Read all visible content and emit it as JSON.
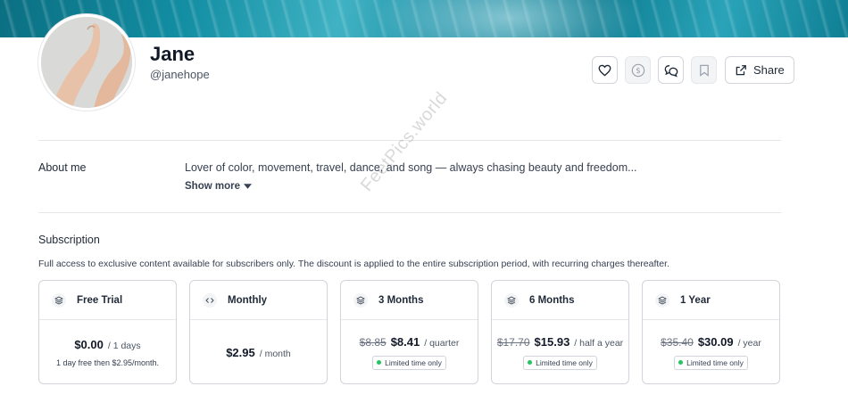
{
  "profile": {
    "name": "Jane",
    "handle": "@janehope"
  },
  "actions": {
    "share_label": "Share",
    "icons": [
      "heart-icon",
      "dollar-icon",
      "chat-icon",
      "bookmark-icon",
      "share-icon"
    ]
  },
  "about": {
    "label": "About me",
    "text": "Lover of color, movement, travel, dance, and song — always chasing beauty and freedom...",
    "show_more": "Show more"
  },
  "subscription": {
    "title": "Subscription",
    "description": "Full access to exclusive content available for subscribers only. The discount is applied to the entire subscription period, with recurring charges thereafter.",
    "plans": [
      {
        "name": "Free Trial",
        "old_price": "",
        "price": "$0.00",
        "period": "/ 1 days",
        "note": "1 day free then $2.95/month.",
        "badge": "",
        "icon": "layers-icon"
      },
      {
        "name": "Monthly",
        "old_price": "",
        "price": "$2.95",
        "period": "/ month",
        "note": "",
        "badge": "",
        "icon": "code-icon"
      },
      {
        "name": "3 Months",
        "old_price": "$8.85",
        "price": "$8.41",
        "period": "/ quarter",
        "note": "",
        "badge": "Limited time only",
        "icon": "layers-icon"
      },
      {
        "name": "6 Months",
        "old_price": "$17.70",
        "price": "$15.93",
        "period": "/ half a year",
        "note": "",
        "badge": "Limited time only",
        "icon": "layers-icon"
      },
      {
        "name": "1 Year",
        "old_price": "$35.40",
        "price": "$30.09",
        "period": "/ year",
        "note": "",
        "badge": "Limited time only",
        "icon": "layers-icon"
      }
    ]
  },
  "watermark": "FeetPics.world",
  "colors": {
    "banner": "#138ea3",
    "badge_dot": "#22c55e",
    "border": "#d1d5db"
  }
}
